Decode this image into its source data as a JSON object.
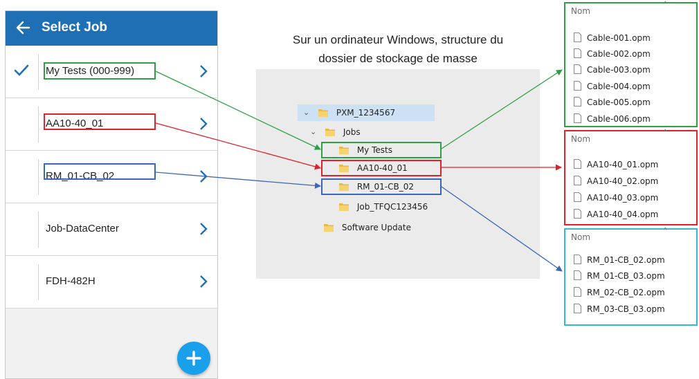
{
  "phone": {
    "title": "Select Job",
    "jobs": [
      {
        "label": "My Tests (000-999)",
        "checked": true
      },
      {
        "label": "AA10-40_01",
        "checked": false
      },
      {
        "label": "RM_01-CB_02",
        "checked": false
      },
      {
        "label": "Job-DataCenter",
        "checked": false
      },
      {
        "label": "FDH-482H",
        "checked": false
      }
    ],
    "accent": "#1f6fb5",
    "fab_color": "#1aa0ea"
  },
  "caption": {
    "line1": "Sur un ordinateur Windows, structure du",
    "line2": "dossier de stockage de masse"
  },
  "tree": {
    "root": "PXM_1234567",
    "jobs": "Jobs",
    "my_tests": "My Tests",
    "aa": "AA10-40_01",
    "rm": "RM_01-CB_02",
    "job_tfqc": "Job_TFQC123456",
    "software_update": "Software Update"
  },
  "panels": [
    {
      "header": "Nom",
      "files": [
        "Cable-001.opm",
        "Cable-002.opm",
        "Cable-003.opm",
        "Cable-004.opm",
        "Cable-005.opm",
        "Cable-006.opm"
      ]
    },
    {
      "header": "Nom",
      "files": [
        "AA10-40_01.opm",
        "AA10-40_02.opm",
        "AA10-40_03.opm",
        "AA10-40_04.opm"
      ]
    },
    {
      "header": "Nom",
      "files": [
        "RM_01-CB_02.opm",
        "RM_01-CB_03.opm",
        "RM_02-CB_02.opm",
        "RM_03-CB_03.opm"
      ]
    }
  ],
  "colors": {
    "green": "#2ea043",
    "red": "#e0202a",
    "blue": "#3b66b8",
    "cyan": "#35b6d6"
  }
}
